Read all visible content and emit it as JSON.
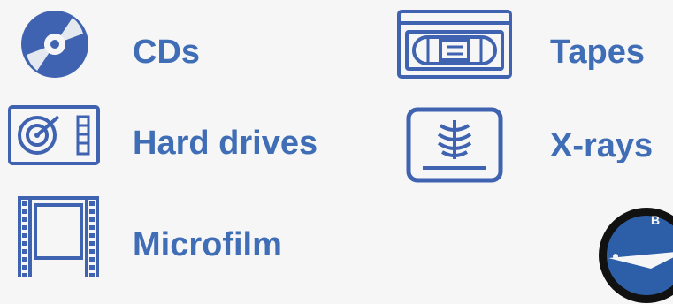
{
  "colors": {
    "accent": "#3f6db6",
    "icon_fill": "#3f63b0",
    "background": "#f6f6f6"
  },
  "items": [
    {
      "label": "CDs",
      "icon": "cd-icon"
    },
    {
      "label": "Tapes",
      "icon": "vhs-tape-icon"
    },
    {
      "label": "Hard drives",
      "icon": "hard-drive-icon"
    },
    {
      "label": "X-rays",
      "icon": "xray-icon"
    },
    {
      "label": "Microfilm",
      "icon": "film-strip-icon"
    }
  ],
  "logo": {
    "icon": "circular-badge-logo",
    "visible_text": "B"
  }
}
